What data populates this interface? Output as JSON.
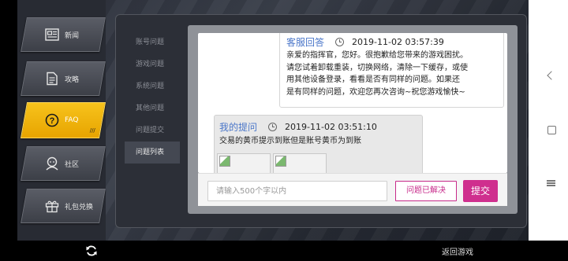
{
  "sidebar": {
    "items": [
      {
        "label": "新闻",
        "icon": "newspaper-icon"
      },
      {
        "label": "攻略",
        "icon": "document-icon"
      },
      {
        "label": "FAQ",
        "icon": "help-icon",
        "marks": "///"
      },
      {
        "label": "社区",
        "icon": "community-icon"
      },
      {
        "label": "礼包兑换",
        "icon": "gift-icon"
      }
    ],
    "active_index": 2,
    "active_color": "#f2b40b"
  },
  "categories": {
    "items": [
      "账号问题",
      "游戏问题",
      "系统问题",
      "其他问题",
      "问题提交",
      "问题列表"
    ],
    "active_index": 5
  },
  "chat": {
    "support_message": {
      "sender": "客服回答",
      "time": "2019-11-02 03:57:39",
      "lines": [
        "亲爱的指挥官，您好。很抱歉给您带来的游戏困扰。",
        "请您试着卸载重装，切换网络，清除一下缓存，或使",
        "用其他设备登录，看看是否有同样的问题。如果还",
        "是有同样的问题，欢迎您再次咨询~祝您游戏愉快~"
      ]
    },
    "user_message": {
      "sender": "我的提问",
      "time": "2019-11-02 03:51:10",
      "text": "交易的黄币提示到账但是账号黄币为到账",
      "images": 2
    }
  },
  "input": {
    "placeholder": "请输入500个字以内",
    "value": "",
    "resolved_label": "问题已解决",
    "submit_label": "提交"
  },
  "bottom": {
    "back_label": "返回游戏",
    "refresh_icon": "refresh-icon"
  },
  "colors": {
    "accent_pink": "#cf2f8e",
    "link_blue": "#4a76c9",
    "faq_yellow": "#f2b40b"
  }
}
